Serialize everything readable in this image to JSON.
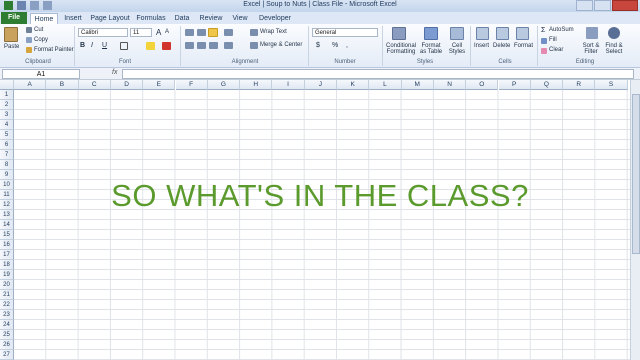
{
  "window": {
    "title": "Excel | Soup to Nuts | Class File  -  Microsoft Excel"
  },
  "tabs": [
    "File",
    "Home",
    "Insert",
    "Page Layout",
    "Formulas",
    "Data",
    "Review",
    "View",
    "Developer"
  ],
  "ribbon": {
    "clipboard": {
      "paste": "Paste",
      "cut": "Cut",
      "copy": "Copy",
      "format_painter": "Format Painter",
      "label": "Clipboard"
    },
    "font": {
      "name": "Calibri",
      "size": "11",
      "label": "Font",
      "bold": "B",
      "italic": "I",
      "underline": "U",
      "grow": "A",
      "shrink": "A"
    },
    "alignment": {
      "wrap": "Wrap Text",
      "merge": "Merge & Center",
      "label": "Alignment"
    },
    "number": {
      "format": "General",
      "currency": "$",
      "percent": "%",
      "comma": ",",
      "label": "Number"
    },
    "styles": {
      "conditional": "Conditional Formatting",
      "format_table": "Format as Table",
      "cell_styles": "Cell Styles",
      "label": "Styles"
    },
    "cells": {
      "insert": "Insert",
      "delete": "Delete",
      "format": "Format",
      "label": "Cells"
    },
    "editing": {
      "autosum": "AutoSum",
      "fill": "Fill",
      "clear": "Clear",
      "sort": "Sort & Filter",
      "find": "Find & Select",
      "label": "Editing"
    }
  },
  "formula_bar": {
    "name_box": "A1",
    "fx": "fx"
  },
  "columns": [
    "A",
    "B",
    "C",
    "D",
    "E",
    "F",
    "G",
    "H",
    "I",
    "J",
    "K",
    "L",
    "M",
    "N",
    "O",
    "P",
    "Q",
    "R",
    "S"
  ],
  "rows": [
    "1",
    "2",
    "3",
    "4",
    "5",
    "6",
    "7",
    "8",
    "9",
    "10",
    "11",
    "12",
    "13",
    "14",
    "15",
    "16",
    "17",
    "18",
    "19",
    "20",
    "21",
    "22",
    "23",
    "24",
    "25",
    "26",
    "27"
  ],
  "headline": "SO WHAT'S IN THE CLASS?",
  "colors": {
    "file_tab": "#2e7d32",
    "headline": "#5b9a2c"
  }
}
